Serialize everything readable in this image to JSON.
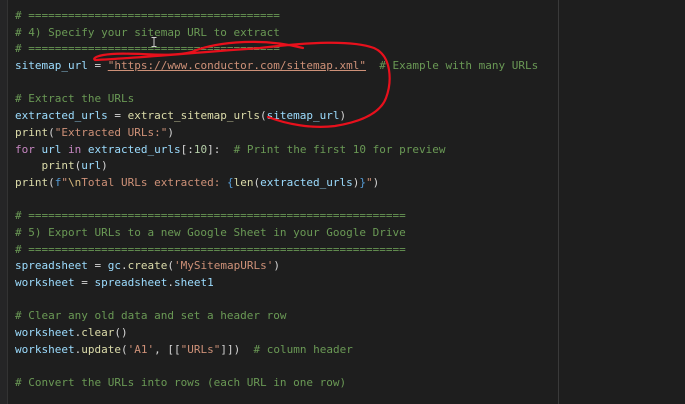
{
  "editor": {
    "lines": [
      [
        {
          "t": "# ======================================",
          "c": "comment"
        }
      ],
      [
        {
          "t": "# 4) Specify your sitemap URL to extract",
          "c": "comment"
        }
      ],
      [
        {
          "t": "# ======================================",
          "c": "comment"
        }
      ],
      [
        {
          "t": "sitemap_url",
          "c": "var"
        },
        {
          "t": " = ",
          "c": "plain"
        },
        {
          "t": "\"https://www.conductor.com/sitemap.xml\"",
          "c": "string",
          "link": true
        },
        {
          "t": "  # Example with many URLs",
          "c": "comment"
        }
      ],
      [],
      [
        {
          "t": "# Extract the URLs",
          "c": "comment"
        }
      ],
      [
        {
          "t": "extracted_urls",
          "c": "var"
        },
        {
          "t": " = ",
          "c": "plain"
        },
        {
          "t": "extract_sitemap_urls",
          "c": "func"
        },
        {
          "t": "(",
          "c": "plain"
        },
        {
          "t": "sitemap_url",
          "c": "var"
        },
        {
          "t": ")",
          "c": "plain"
        }
      ],
      [
        {
          "t": "print",
          "c": "builtin"
        },
        {
          "t": "(",
          "c": "plain"
        },
        {
          "t": "\"Extracted URLs:\"",
          "c": "string"
        },
        {
          "t": ")",
          "c": "plain"
        }
      ],
      [
        {
          "t": "for",
          "c": "keyword"
        },
        {
          "t": " ",
          "c": "plain"
        },
        {
          "t": "url",
          "c": "var"
        },
        {
          "t": " ",
          "c": "plain"
        },
        {
          "t": "in",
          "c": "keyword"
        },
        {
          "t": " ",
          "c": "plain"
        },
        {
          "t": "extracted_urls",
          "c": "var"
        },
        {
          "t": "[:",
          "c": "plain"
        },
        {
          "t": "10",
          "c": "number"
        },
        {
          "t": "]:",
          "c": "plain"
        },
        {
          "t": "  # Print the first 10 for preview",
          "c": "comment"
        }
      ],
      [
        {
          "t": "    ",
          "c": "plain"
        },
        {
          "t": "print",
          "c": "builtin"
        },
        {
          "t": "(",
          "c": "plain"
        },
        {
          "t": "url",
          "c": "var"
        },
        {
          "t": ")",
          "c": "plain"
        }
      ],
      [
        {
          "t": "print",
          "c": "builtin"
        },
        {
          "t": "(",
          "c": "plain"
        },
        {
          "t": "f",
          "c": "brace"
        },
        {
          "t": "\"",
          "c": "string"
        },
        {
          "t": "\\n",
          "c": "escape"
        },
        {
          "t": "Total URLs extracted: ",
          "c": "string"
        },
        {
          "t": "{",
          "c": "brace"
        },
        {
          "t": "len",
          "c": "builtin"
        },
        {
          "t": "(",
          "c": "plain"
        },
        {
          "t": "extracted_urls",
          "c": "var"
        },
        {
          "t": ")",
          "c": "plain"
        },
        {
          "t": "}",
          "c": "brace"
        },
        {
          "t": "\"",
          "c": "string"
        },
        {
          "t": ")",
          "c": "plain"
        }
      ],
      [],
      [
        {
          "t": "# =========================================================",
          "c": "comment"
        }
      ],
      [
        {
          "t": "# 5) Export URLs to a new Google Sheet in your Google Drive",
          "c": "comment"
        }
      ],
      [
        {
          "t": "# =========================================================",
          "c": "comment"
        }
      ],
      [
        {
          "t": "spreadsheet",
          "c": "var"
        },
        {
          "t": " = ",
          "c": "plain"
        },
        {
          "t": "gc",
          "c": "var"
        },
        {
          "t": ".",
          "c": "plain"
        },
        {
          "t": "create",
          "c": "func"
        },
        {
          "t": "(",
          "c": "plain"
        },
        {
          "t": "'MySitemapURLs'",
          "c": "string"
        },
        {
          "t": ")",
          "c": "plain"
        }
      ],
      [
        {
          "t": "worksheet",
          "c": "var"
        },
        {
          "t": " = ",
          "c": "plain"
        },
        {
          "t": "spreadsheet",
          "c": "var"
        },
        {
          "t": ".",
          "c": "plain"
        },
        {
          "t": "sheet1",
          "c": "var"
        }
      ],
      [],
      [
        {
          "t": "# Clear any old data and set a header row",
          "c": "comment"
        }
      ],
      [
        {
          "t": "worksheet",
          "c": "var"
        },
        {
          "t": ".",
          "c": "plain"
        },
        {
          "t": "clear",
          "c": "func"
        },
        {
          "t": "()",
          "c": "plain"
        }
      ],
      [
        {
          "t": "worksheet",
          "c": "var"
        },
        {
          "t": ".",
          "c": "plain"
        },
        {
          "t": "update",
          "c": "func"
        },
        {
          "t": "(",
          "c": "plain"
        },
        {
          "t": "'A1'",
          "c": "string"
        },
        {
          "t": ", [[",
          "c": "plain"
        },
        {
          "t": "\"URLs\"",
          "c": "string"
        },
        {
          "t": "]])",
          "c": "plain"
        },
        {
          "t": "  # column header",
          "c": "comment"
        }
      ],
      [],
      [
        {
          "t": "# Convert the URLs into rows (each URL in one row)",
          "c": "comment"
        }
      ]
    ]
  },
  "colors": {
    "background": "#1e1e1e",
    "annotation": "#e8101c"
  }
}
